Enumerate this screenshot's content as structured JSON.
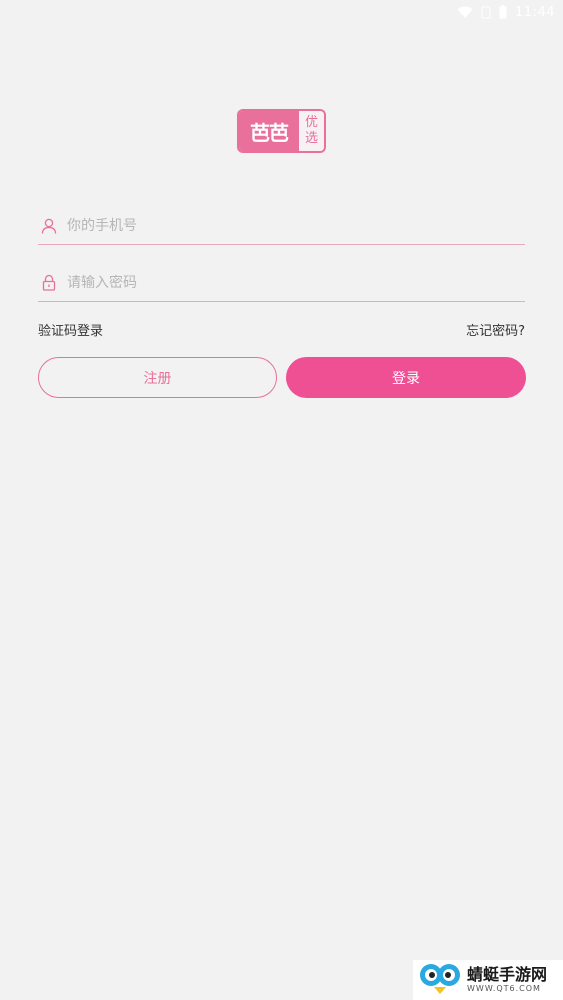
{
  "status_bar": {
    "time": "11:44",
    "icons": [
      "wifi-icon",
      "no-sim-icon",
      "battery-icon"
    ]
  },
  "logo": {
    "main_text": "芭芭",
    "side_line1": "优",
    "side_line2": "选"
  },
  "form": {
    "phone_placeholder": "你的手机号",
    "phone_value": "",
    "password_placeholder": "请输入密码",
    "password_value": "",
    "sms_login_label": "验证码登录",
    "forgot_password_label": "忘记密码?",
    "register_label": "注册",
    "login_label": "登录"
  },
  "watermark": {
    "title": "蜻蜓手游网",
    "url": "WWW.QT6.COM"
  },
  "colors": {
    "background": "#f2f2f2",
    "accent": "#ef5094",
    "accent_light": "#e8709a",
    "underline": "#e9a9bf"
  }
}
